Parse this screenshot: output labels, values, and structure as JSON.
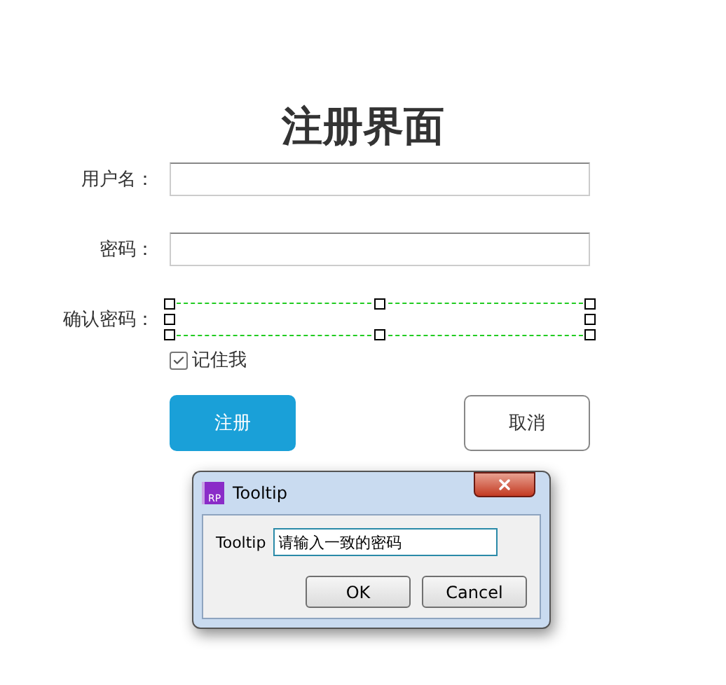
{
  "form": {
    "title": "注册界面",
    "fields": [
      {
        "label": "用户名：",
        "selected": false
      },
      {
        "label": "密码：",
        "selected": false
      },
      {
        "label": "确认密码：",
        "selected": true
      }
    ],
    "remember": {
      "label": "记住我",
      "checked": true
    },
    "buttons": [
      {
        "label": "注册",
        "kind": "primary"
      },
      {
        "label": "取消",
        "kind": "secondary"
      }
    ]
  },
  "dialog": {
    "app_icon": "RP",
    "title": "Tooltip",
    "field_label": "Tooltip",
    "field_value": "请输入一致的密码",
    "buttons": [
      "OK",
      "Cancel"
    ]
  }
}
